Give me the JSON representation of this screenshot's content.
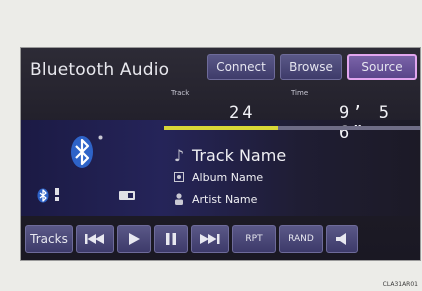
{
  "header": {
    "title": "Bluetooth Audio",
    "buttons": [
      {
        "label": "Connect",
        "active": false
      },
      {
        "label": "Browse",
        "active": false
      },
      {
        "label": "Source",
        "active": true
      }
    ]
  },
  "playback": {
    "track_label": "Track",
    "track_number": "24",
    "time_label": "Time",
    "time_value": "9’ 5 6”",
    "progress_fraction": 0.44
  },
  "now_playing": {
    "track_name": "Track Name",
    "album_name": "Album Name",
    "artist_name": "Artist Name"
  },
  "status": {
    "bluetooth_icon": "bluetooth-icon",
    "battery_fraction": 0.6
  },
  "controls": {
    "tracks_label": "Tracks",
    "rpt_label": "RPT",
    "rand_label": "RAND"
  },
  "footer": {
    "code": "CLA31AR01"
  },
  "colors": {
    "button_bg": "#4b4878",
    "button_active_border": "#e2a6ef",
    "progress_fill": "#d8d638",
    "text": "#f0f0f4"
  }
}
